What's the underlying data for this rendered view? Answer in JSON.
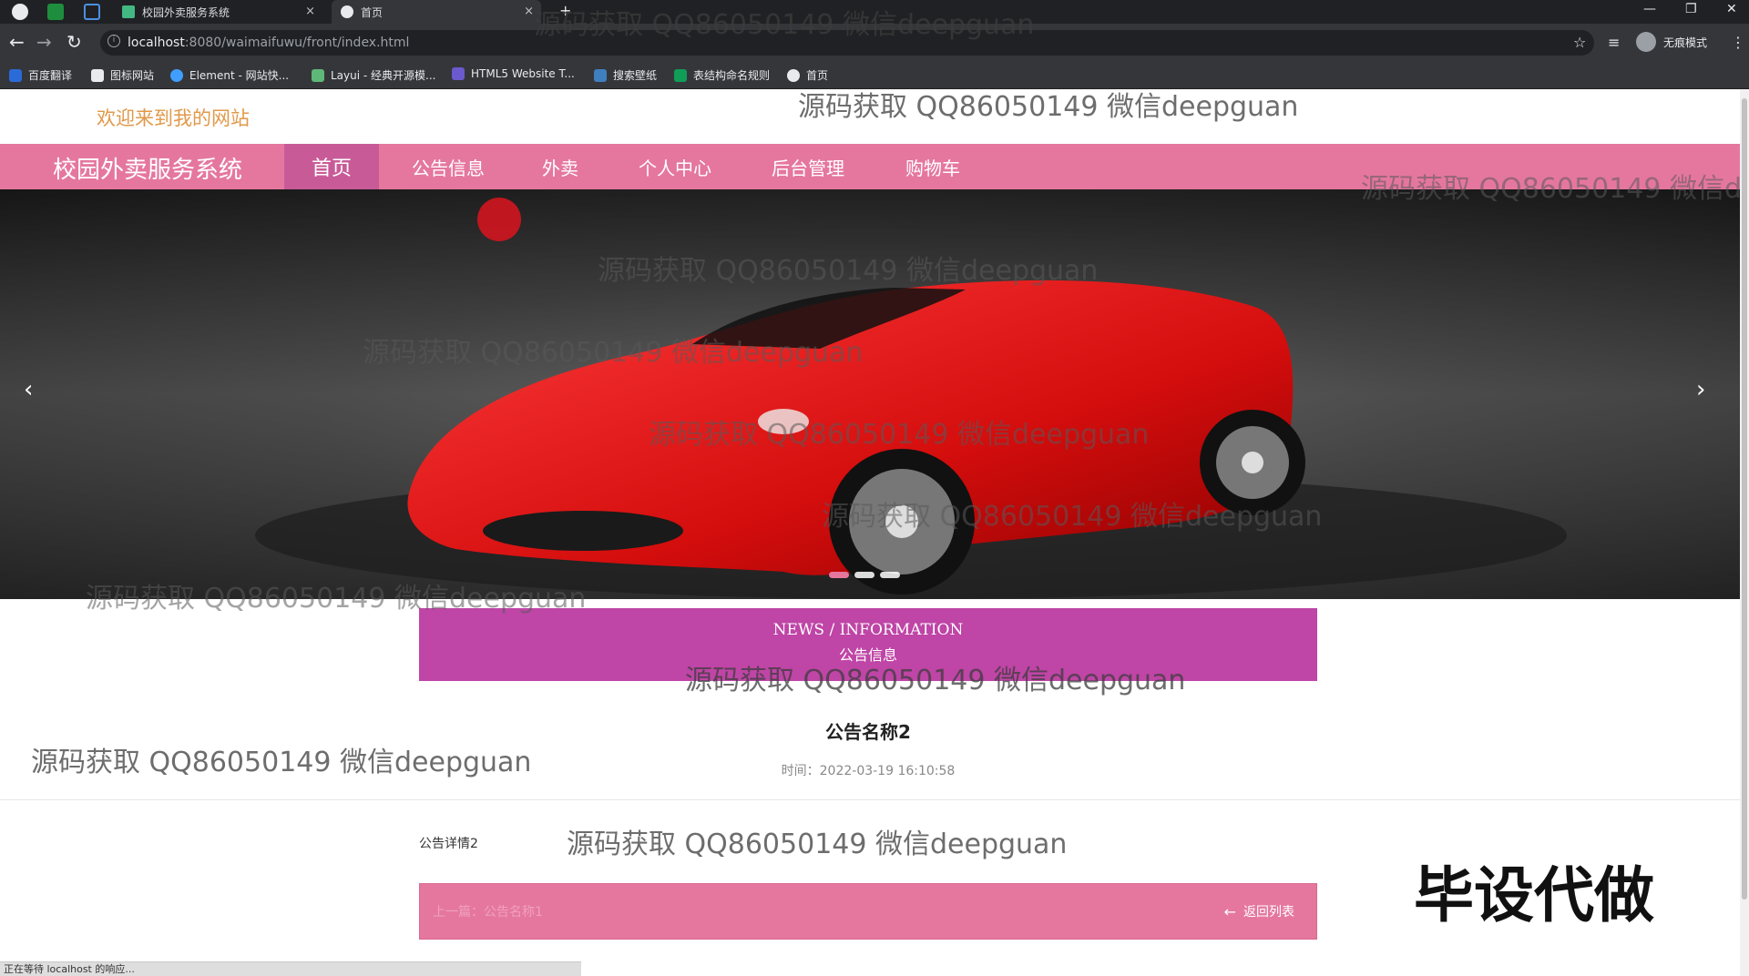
{
  "browser": {
    "tabs": [
      {
        "title": "校园外卖服务系统",
        "close": "×"
      },
      {
        "title": "首页",
        "close": "×"
      }
    ],
    "new_tab": "+",
    "window_controls": {
      "minimize": "—",
      "restore": "❐",
      "close": "✕"
    },
    "url_host": "localhost",
    "url_rest": ":8080/waimaifuwu/front/index.html",
    "nav_icons": {
      "back": "arrow-left-icon",
      "forward": "arrow-right-icon",
      "reload": "reload-icon"
    },
    "profile_label": "无痕模式",
    "bookmarks": [
      "百度翻译",
      "图标网站",
      "Element - 网站快...",
      "Layui - 经典开源模...",
      "HTML5 Website T...",
      "搜索壁纸",
      "表结构命名规则",
      "首页"
    ]
  },
  "site": {
    "welcome": "欢迎来到我的网站",
    "brand": "校园外卖服务系统",
    "nav": [
      "首页",
      "公告信息",
      "外卖",
      "个人中心",
      "后台管理",
      "购物车"
    ],
    "active_nav": "首页",
    "carousel": {
      "prev": "‹",
      "next": "›",
      "slides": 3,
      "active_slide": 1
    }
  },
  "news": {
    "heading_en": "NEWS / INFORMATION",
    "heading_cn": "公告信息"
  },
  "article": {
    "title": "公告名称2",
    "time": "时间：2022-03-19 16:10:58",
    "detail": "公告详情2",
    "prev": "上一篇：公告名称1",
    "back": "返回列表"
  },
  "status_text": "正在等待 localhost 的响应...",
  "watermark": "源码获取 QQ86050149 微信deepguan",
  "stamp": "毕设代做",
  "colors": {
    "nav_bg": "#e5779e",
    "nav_active": "#c85b97",
    "news_bar": "#bf45a6",
    "welcome": "#e0994a"
  }
}
